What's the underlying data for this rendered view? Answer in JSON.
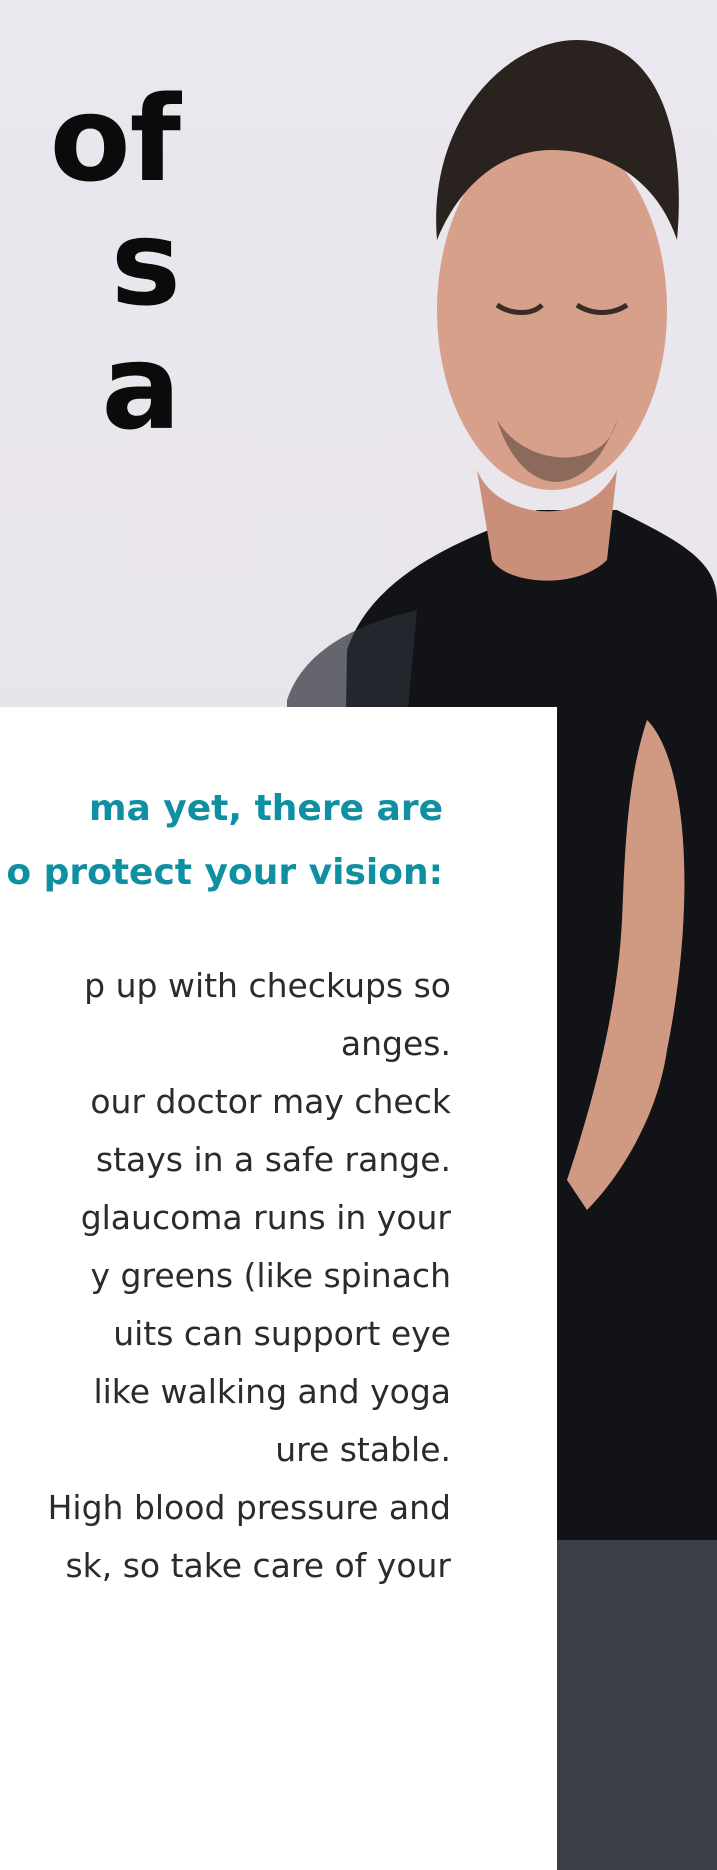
{
  "headline": {
    "text": "of\ns a"
  },
  "card": {
    "heading": "ma yet, there are\no protect your vision:",
    "items": [
      "p up with checkups so\nanges.",
      "our doctor may check\nstays in a safe range.",
      "glaucoma runs in your\n ",
      "y greens (like spinach\nuits can support eye\n ",
      "like walking and yoga\nure stable.",
      "High blood pressure and\nsk, so take care of your"
    ]
  },
  "colors": {
    "accent": "#0e8fa2",
    "card_bg": "#ffffff",
    "headline": "#0b0b0b",
    "body_text": "#2b2b2b"
  },
  "icons": {
    "photo": "man-meditating-photo"
  }
}
